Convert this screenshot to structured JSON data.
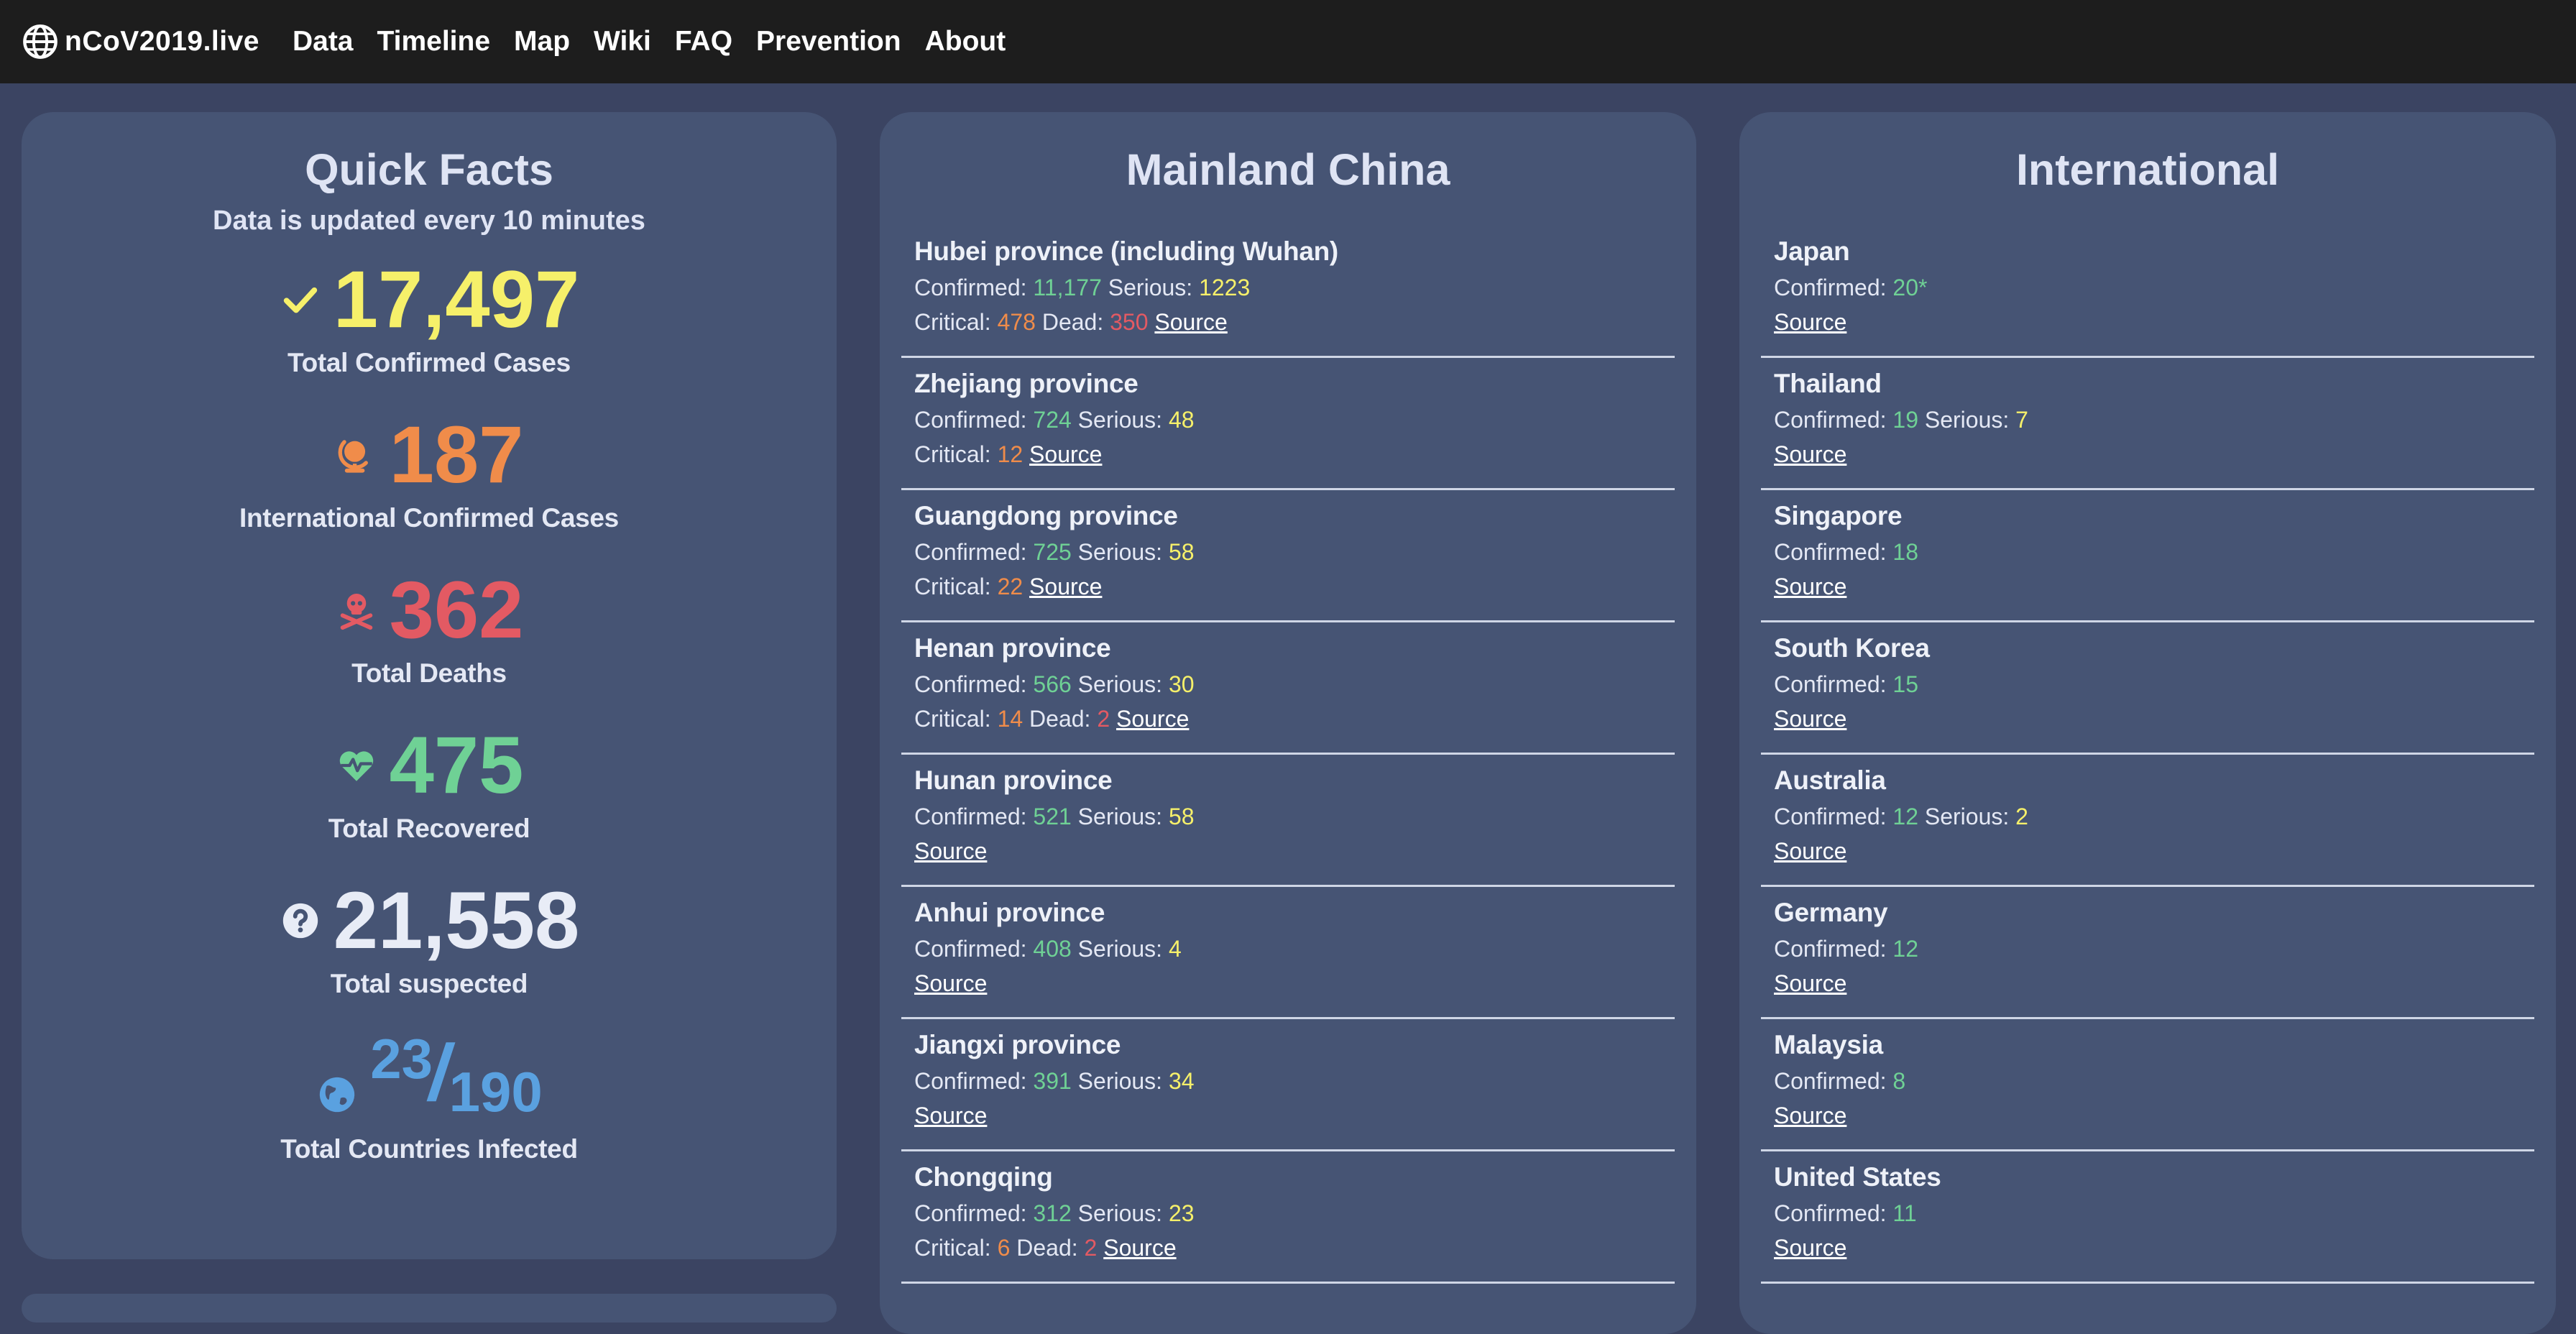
{
  "nav": {
    "brand": "nCoV2019.live",
    "links": [
      "Data",
      "Timeline",
      "Map",
      "Wiki",
      "FAQ",
      "Prevention",
      "About"
    ]
  },
  "facts": {
    "title": "Quick Facts",
    "subtitle": "Data is updated every 10 minutes",
    "confirmed": {
      "value": "17,497",
      "label": "Total Confirmed Cases"
    },
    "international": {
      "value": "187",
      "label": "International Confirmed Cases"
    },
    "deaths": {
      "value": "362",
      "label": "Total Deaths"
    },
    "recovered": {
      "value": "475",
      "label": "Total Recovered"
    },
    "suspected": {
      "value": "21,558",
      "label": "Total suspected"
    },
    "countries": {
      "infected": "23",
      "total": "190",
      "label": "Total Countries Infected"
    }
  },
  "china": {
    "title": "Mainland China",
    "entries": [
      {
        "name": "Hubei province (including Wuhan)",
        "confirmed": "11,177",
        "serious": "1223",
        "critical": "478",
        "dead": "350"
      },
      {
        "name": "Zhejiang province",
        "confirmed": "724",
        "serious": "48",
        "critical": "12"
      },
      {
        "name": "Guangdong province",
        "confirmed": "725",
        "serious": "58",
        "critical": "22"
      },
      {
        "name": "Henan province",
        "confirmed": "566",
        "serious": "30",
        "critical": "14",
        "dead": "2"
      },
      {
        "name": "Hunan province",
        "confirmed": "521",
        "serious": "58"
      },
      {
        "name": "Anhui province",
        "confirmed": "408",
        "serious": "4"
      },
      {
        "name": "Jiangxi province",
        "confirmed": "391",
        "serious": "34"
      },
      {
        "name": "Chongqing",
        "confirmed": "312",
        "serious": "23",
        "critical": "6",
        "dead": "2"
      }
    ]
  },
  "intl": {
    "title": "International",
    "entries": [
      {
        "name": "Japan",
        "confirmed": "20*"
      },
      {
        "name": "Thailand",
        "confirmed": "19",
        "serious": "7"
      },
      {
        "name": "Singapore",
        "confirmed": "18"
      },
      {
        "name": "South Korea",
        "confirmed": "15"
      },
      {
        "name": "Australia",
        "confirmed": "12",
        "serious": "2"
      },
      {
        "name": "Germany",
        "confirmed": "12"
      },
      {
        "name": "Malaysia",
        "confirmed": "8"
      },
      {
        "name": "United States",
        "confirmed": "11"
      }
    ]
  },
  "labels": {
    "confirmed": "Confirmed:",
    "serious": "Serious:",
    "critical": "Critical:",
    "dead": "Dead:",
    "source": "Source"
  },
  "colors": {
    "confirmed": "#6fd195",
    "serious": "#f6f06a",
    "critical": "#f08c4a",
    "dead": "#e35a63",
    "card": "#465474",
    "background": "#3b4462",
    "nav": "#1d1d1d"
  },
  "icons": {
    "brand": "globe-icon",
    "confirmed": "checkmark-icon",
    "international": "globe-stand-icon",
    "deaths": "skull-crossbones-icon",
    "recovered": "heartbeat-icon",
    "suspected": "question-circle-icon",
    "countries": "earth-icon"
  }
}
